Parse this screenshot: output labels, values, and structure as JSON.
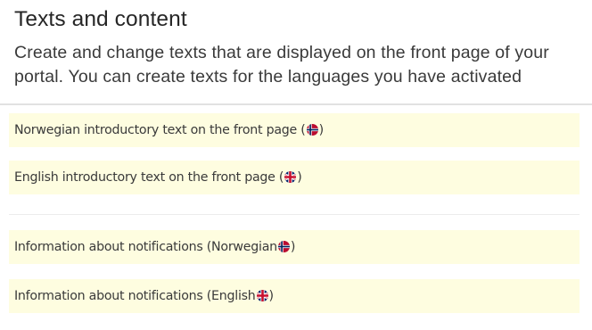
{
  "header": {
    "title": "Texts and content",
    "description": "Create and change texts that are displayed on the front page of your portal. You can create texts for the languages you have activated"
  },
  "rows": [
    {
      "label": "Norwegian introductory text on the front page (",
      "suffix": ")",
      "flag": "norway-flag-icon"
    },
    {
      "label": "English introductory text on the front page (",
      "suffix": ")",
      "flag": "uk-flag-icon"
    },
    {
      "label": "Information about notifications (Norwegian",
      "suffix": ")",
      "flag": "norway-flag-icon"
    },
    {
      "label": "Information about notifications (English",
      "suffix": ")",
      "flag": "uk-flag-icon"
    }
  ],
  "colors": {
    "row_background": "#fefde0",
    "divider": "#e1e1e1"
  }
}
